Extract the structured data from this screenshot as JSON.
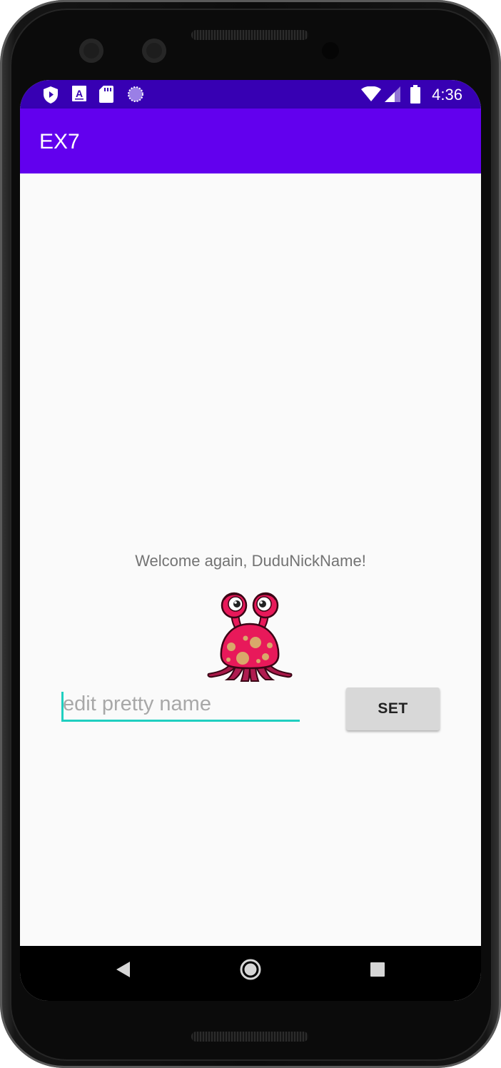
{
  "status_bar": {
    "time": "4:36",
    "left_icons": [
      "shield-icon",
      "a-box-icon",
      "sd-card-icon",
      "loading-circle-icon"
    ],
    "right_icons": [
      "wifi-icon",
      "signal-icon",
      "battery-icon"
    ]
  },
  "app_bar": {
    "title": "EX7"
  },
  "main": {
    "welcome_text": "Welcome again, DuduNickName!",
    "name_input": {
      "placeholder": "edit pretty name",
      "value": ""
    },
    "set_button_label": "SET"
  },
  "nav_bar": {
    "buttons": [
      "back-icon",
      "home-icon",
      "recents-icon"
    ]
  },
  "colors": {
    "status_bar": "#3700b3",
    "app_bar": "#6200ee",
    "accent": "#1fcfc0",
    "button": "#d8d8d8"
  }
}
